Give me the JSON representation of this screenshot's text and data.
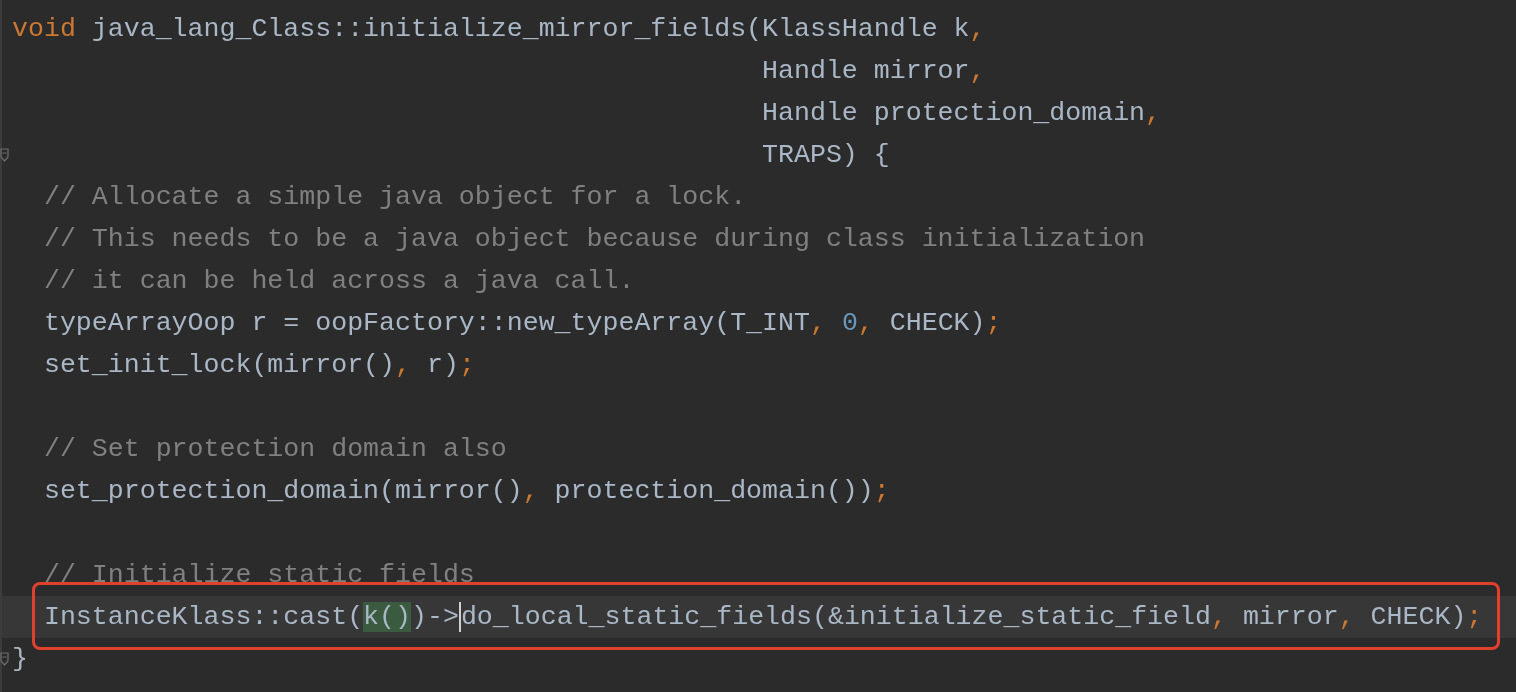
{
  "editor": {
    "lines": [
      {
        "fold": false,
        "current": false,
        "framed": false,
        "tokens": [
          {
            "kind": "keyword",
            "text": "void"
          },
          {
            "kind": "plain",
            "text": " java_lang_Class::initialize_mirror_fields(KlassHandle k"
          },
          {
            "kind": "punct",
            "text": ","
          }
        ]
      },
      {
        "fold": false,
        "current": false,
        "framed": false,
        "tokens": [
          {
            "kind": "plain",
            "text": "                                               Handle mirror"
          },
          {
            "kind": "punct",
            "text": ","
          }
        ]
      },
      {
        "fold": false,
        "current": false,
        "framed": false,
        "tokens": [
          {
            "kind": "plain",
            "text": "                                               Handle protection_domain"
          },
          {
            "kind": "punct",
            "text": ","
          }
        ]
      },
      {
        "fold": true,
        "current": false,
        "framed": false,
        "tokens": [
          {
            "kind": "plain",
            "text": "                                               TRAPS) {"
          }
        ]
      },
      {
        "fold": false,
        "current": false,
        "framed": false,
        "tokens": [
          {
            "kind": "comment",
            "text": "  // Allocate a simple java object for a lock."
          }
        ]
      },
      {
        "fold": false,
        "current": false,
        "framed": false,
        "tokens": [
          {
            "kind": "comment",
            "text": "  // This needs to be a java object because during class initialization"
          }
        ]
      },
      {
        "fold": false,
        "current": false,
        "framed": false,
        "tokens": [
          {
            "kind": "comment",
            "text": "  // it can be held across a java call."
          }
        ]
      },
      {
        "fold": false,
        "current": false,
        "framed": false,
        "tokens": [
          {
            "kind": "plain",
            "text": "  typeArrayOop r = oopFactory::new_typeArray(T_INT"
          },
          {
            "kind": "punct",
            "text": ","
          },
          {
            "kind": "number",
            "text": " 0"
          },
          {
            "kind": "punct",
            "text": ","
          },
          {
            "kind": "plain",
            "text": " CHECK)"
          },
          {
            "kind": "punct",
            "text": ";"
          }
        ]
      },
      {
        "fold": false,
        "current": false,
        "framed": false,
        "tokens": [
          {
            "kind": "plain",
            "text": "  set_init_lock(mirror()"
          },
          {
            "kind": "punct",
            "text": ","
          },
          {
            "kind": "plain",
            "text": " r)"
          },
          {
            "kind": "punct",
            "text": ";"
          }
        ]
      },
      {
        "fold": false,
        "current": false,
        "framed": false
      },
      {
        "fold": false,
        "current": false,
        "framed": false,
        "tokens": [
          {
            "kind": "comment",
            "text": "  // Set protection domain also"
          }
        ]
      },
      {
        "fold": false,
        "current": false,
        "framed": false,
        "tokens": [
          {
            "kind": "plain",
            "text": "  set_protection_domain(mirror()"
          },
          {
            "kind": "punct",
            "text": ","
          },
          {
            "kind": "plain",
            "text": " protection_domain())"
          },
          {
            "kind": "punct",
            "text": ";"
          }
        ]
      },
      {
        "fold": false,
        "current": false,
        "framed": false
      },
      {
        "fold": false,
        "current": false,
        "framed": false,
        "tokens": [
          {
            "kind": "comment",
            "text": "  // Initialize static fields"
          }
        ]
      },
      {
        "fold": false,
        "current": true,
        "framed": true,
        "tokens": [
          {
            "kind": "plain",
            "text": "  InstanceKlass::cast("
          },
          {
            "kind": "match",
            "text": "k()"
          },
          {
            "kind": "plain",
            "text": ")->"
          },
          {
            "kind": "caret"
          },
          {
            "kind": "plain",
            "text": "do_local_static_fields(&initialize_static_field"
          },
          {
            "kind": "punct",
            "text": ","
          },
          {
            "kind": "plain",
            "text": " mirror"
          },
          {
            "kind": "punct",
            "text": ","
          },
          {
            "kind": "plain",
            "text": " CHECK)"
          },
          {
            "kind": "punct",
            "text": ";"
          }
        ]
      },
      {
        "fold": true,
        "current": false,
        "framed": false,
        "tokens": [
          {
            "kind": "plain",
            "text": "}"
          }
        ]
      }
    ]
  }
}
